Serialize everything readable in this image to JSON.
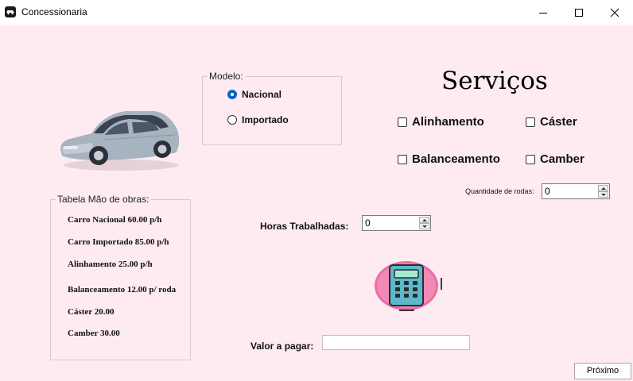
{
  "window": {
    "title": "Concessionaria"
  },
  "modelo": {
    "title": "Modelo:",
    "options": [
      {
        "label": "Nacional",
        "selected": true
      },
      {
        "label": "Importado",
        "selected": false
      }
    ]
  },
  "services": {
    "title": "Serviços",
    "options": [
      {
        "label": "Alinhamento",
        "checked": false
      },
      {
        "label": "Cáster",
        "checked": false
      },
      {
        "label": "Balanceamento",
        "checked": false
      },
      {
        "label": "Camber",
        "checked": false
      }
    ]
  },
  "wheels": {
    "label": "Quantidade de rodas:",
    "value": "0"
  },
  "hours": {
    "label": "Horas Trabalhadas:",
    "value": "0"
  },
  "price_table": {
    "title": "Tabela Mão de obras:",
    "items": [
      "Carro Nacional 60.00 p/h",
      "Carro Importado 85.00 p/h",
      "Alinhamento 25.00 p/h",
      "Balanceamento 12.00 p/ roda",
      "Cáster 20.00",
      "Camber 30.00"
    ]
  },
  "payment": {
    "label": "Valor a pagar:",
    "value": ""
  },
  "next_button": "Próximo",
  "icons": {
    "car": "car-image",
    "calculator": "calculator-icon"
  },
  "colors": {
    "background": "#fdebf1",
    "accent": "#0067c0",
    "calc_body": "#6ec6d6",
    "calc_bg": "#ec6ea3"
  }
}
